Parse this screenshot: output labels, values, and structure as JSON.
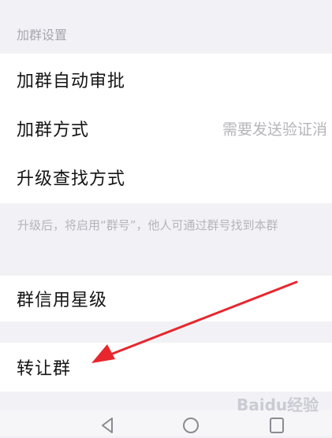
{
  "section": {
    "title": "加群设置"
  },
  "rows": [
    {
      "label": "加群自动审批"
    },
    {
      "label": "加群方式",
      "value": "需要发送验证消"
    },
    {
      "label": "升级查找方式"
    }
  ],
  "upgrade_hint": "升级后，将启用“群号”，他人可通过群号找到本群",
  "credit": {
    "label": "群信用星级"
  },
  "transfer": {
    "label": "转让群"
  },
  "navbar": {
    "icons": [
      "back-triangle-icon",
      "home-circle-icon",
      "recents-square-icon"
    ]
  },
  "watermark": "Baidu经验",
  "colors": {
    "annotation_arrow": "#e8262d",
    "background": "#f2f2f6"
  }
}
